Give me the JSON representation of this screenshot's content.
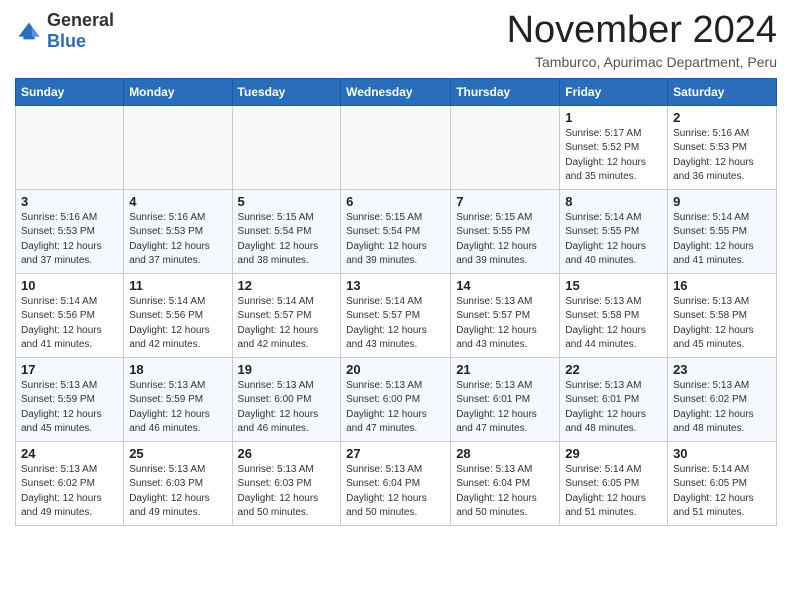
{
  "header": {
    "logo_general": "General",
    "logo_blue": "Blue",
    "month_title": "November 2024",
    "subtitle": "Tamburco, Apurimac Department, Peru"
  },
  "days_of_week": [
    "Sunday",
    "Monday",
    "Tuesday",
    "Wednesday",
    "Thursday",
    "Friday",
    "Saturday"
  ],
  "weeks": [
    [
      {
        "day": "",
        "info": ""
      },
      {
        "day": "",
        "info": ""
      },
      {
        "day": "",
        "info": ""
      },
      {
        "day": "",
        "info": ""
      },
      {
        "day": "",
        "info": ""
      },
      {
        "day": "1",
        "info": "Sunrise: 5:17 AM\nSunset: 5:52 PM\nDaylight: 12 hours\nand 35 minutes."
      },
      {
        "day": "2",
        "info": "Sunrise: 5:16 AM\nSunset: 5:53 PM\nDaylight: 12 hours\nand 36 minutes."
      }
    ],
    [
      {
        "day": "3",
        "info": "Sunrise: 5:16 AM\nSunset: 5:53 PM\nDaylight: 12 hours\nand 37 minutes."
      },
      {
        "day": "4",
        "info": "Sunrise: 5:16 AM\nSunset: 5:53 PM\nDaylight: 12 hours\nand 37 minutes."
      },
      {
        "day": "5",
        "info": "Sunrise: 5:15 AM\nSunset: 5:54 PM\nDaylight: 12 hours\nand 38 minutes."
      },
      {
        "day": "6",
        "info": "Sunrise: 5:15 AM\nSunset: 5:54 PM\nDaylight: 12 hours\nand 39 minutes."
      },
      {
        "day": "7",
        "info": "Sunrise: 5:15 AM\nSunset: 5:55 PM\nDaylight: 12 hours\nand 39 minutes."
      },
      {
        "day": "8",
        "info": "Sunrise: 5:14 AM\nSunset: 5:55 PM\nDaylight: 12 hours\nand 40 minutes."
      },
      {
        "day": "9",
        "info": "Sunrise: 5:14 AM\nSunset: 5:55 PM\nDaylight: 12 hours\nand 41 minutes."
      }
    ],
    [
      {
        "day": "10",
        "info": "Sunrise: 5:14 AM\nSunset: 5:56 PM\nDaylight: 12 hours\nand 41 minutes."
      },
      {
        "day": "11",
        "info": "Sunrise: 5:14 AM\nSunset: 5:56 PM\nDaylight: 12 hours\nand 42 minutes."
      },
      {
        "day": "12",
        "info": "Sunrise: 5:14 AM\nSunset: 5:57 PM\nDaylight: 12 hours\nand 42 minutes."
      },
      {
        "day": "13",
        "info": "Sunrise: 5:14 AM\nSunset: 5:57 PM\nDaylight: 12 hours\nand 43 minutes."
      },
      {
        "day": "14",
        "info": "Sunrise: 5:13 AM\nSunset: 5:57 PM\nDaylight: 12 hours\nand 43 minutes."
      },
      {
        "day": "15",
        "info": "Sunrise: 5:13 AM\nSunset: 5:58 PM\nDaylight: 12 hours\nand 44 minutes."
      },
      {
        "day": "16",
        "info": "Sunrise: 5:13 AM\nSunset: 5:58 PM\nDaylight: 12 hours\nand 45 minutes."
      }
    ],
    [
      {
        "day": "17",
        "info": "Sunrise: 5:13 AM\nSunset: 5:59 PM\nDaylight: 12 hours\nand 45 minutes."
      },
      {
        "day": "18",
        "info": "Sunrise: 5:13 AM\nSunset: 5:59 PM\nDaylight: 12 hours\nand 46 minutes."
      },
      {
        "day": "19",
        "info": "Sunrise: 5:13 AM\nSunset: 6:00 PM\nDaylight: 12 hours\nand 46 minutes."
      },
      {
        "day": "20",
        "info": "Sunrise: 5:13 AM\nSunset: 6:00 PM\nDaylight: 12 hours\nand 47 minutes."
      },
      {
        "day": "21",
        "info": "Sunrise: 5:13 AM\nSunset: 6:01 PM\nDaylight: 12 hours\nand 47 minutes."
      },
      {
        "day": "22",
        "info": "Sunrise: 5:13 AM\nSunset: 6:01 PM\nDaylight: 12 hours\nand 48 minutes."
      },
      {
        "day": "23",
        "info": "Sunrise: 5:13 AM\nSunset: 6:02 PM\nDaylight: 12 hours\nand 48 minutes."
      }
    ],
    [
      {
        "day": "24",
        "info": "Sunrise: 5:13 AM\nSunset: 6:02 PM\nDaylight: 12 hours\nand 49 minutes."
      },
      {
        "day": "25",
        "info": "Sunrise: 5:13 AM\nSunset: 6:03 PM\nDaylight: 12 hours\nand 49 minutes."
      },
      {
        "day": "26",
        "info": "Sunrise: 5:13 AM\nSunset: 6:03 PM\nDaylight: 12 hours\nand 50 minutes."
      },
      {
        "day": "27",
        "info": "Sunrise: 5:13 AM\nSunset: 6:04 PM\nDaylight: 12 hours\nand 50 minutes."
      },
      {
        "day": "28",
        "info": "Sunrise: 5:13 AM\nSunset: 6:04 PM\nDaylight: 12 hours\nand 50 minutes."
      },
      {
        "day": "29",
        "info": "Sunrise: 5:14 AM\nSunset: 6:05 PM\nDaylight: 12 hours\nand 51 minutes."
      },
      {
        "day": "30",
        "info": "Sunrise: 5:14 AM\nSunset: 6:05 PM\nDaylight: 12 hours\nand 51 minutes."
      }
    ]
  ]
}
